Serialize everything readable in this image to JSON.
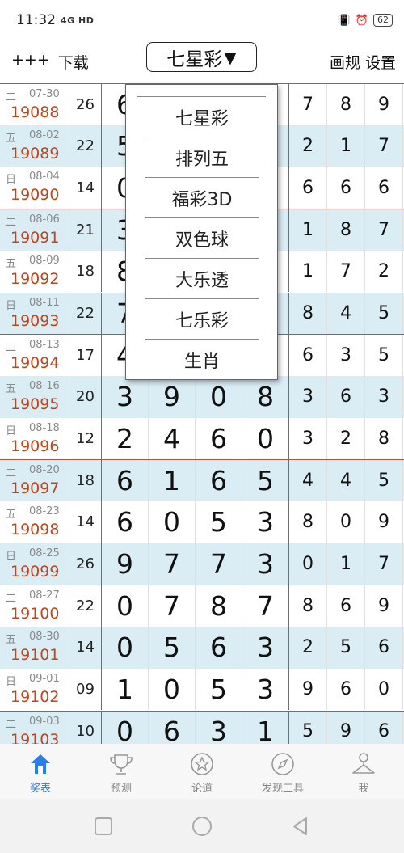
{
  "status": {
    "time": "11:32",
    "network": "4G HD",
    "battery": "62"
  },
  "header": {
    "left_items": [
      "+++",
      "下载"
    ],
    "selector_label": "七星彩",
    "selector_arrow": "▼",
    "right_items": [
      "画规",
      "设置"
    ]
  },
  "dropdown": {
    "items": [
      "七星彩",
      "排列五",
      "福彩3D",
      "双色球",
      "大乐透",
      "七乐彩",
      "生肖"
    ]
  },
  "table": {
    "rows": [
      {
        "weekday": "二",
        "date": "07-30",
        "issue": "19088",
        "sum": "26",
        "digits": [
          "6",
          "",
          "",
          ""
        ],
        "tail": [
          "7",
          "8",
          "9"
        ]
      },
      {
        "weekday": "五",
        "date": "08-02",
        "issue": "19089",
        "sum": "22",
        "digits": [
          "5",
          "",
          "",
          ""
        ],
        "tail": [
          "2",
          "1",
          "7"
        ]
      },
      {
        "weekday": "日",
        "date": "08-04",
        "issue": "19090",
        "sum": "14",
        "digits": [
          "0",
          "",
          "",
          ""
        ],
        "tail": [
          "6",
          "6",
          "6"
        ]
      },
      {
        "weekday": "二",
        "date": "08-06",
        "issue": "19091",
        "sum": "21",
        "digits": [
          "3",
          "",
          "",
          ""
        ],
        "tail": [
          "1",
          "8",
          "7"
        ]
      },
      {
        "weekday": "五",
        "date": "08-09",
        "issue": "19092",
        "sum": "18",
        "digits": [
          "8",
          "",
          "",
          ""
        ],
        "tail": [
          "1",
          "7",
          "2"
        ]
      },
      {
        "weekday": "日",
        "date": "08-11",
        "issue": "19093",
        "sum": "22",
        "digits": [
          "7",
          "",
          "",
          ""
        ],
        "tail": [
          "8",
          "4",
          "5"
        ]
      },
      {
        "weekday": "二",
        "date": "08-13",
        "issue": "19094",
        "sum": "17",
        "digits": [
          "4",
          "",
          "",
          ""
        ],
        "tail": [
          "6",
          "3",
          "5"
        ]
      },
      {
        "weekday": "五",
        "date": "08-16",
        "issue": "19095",
        "sum": "20",
        "digits": [
          "3",
          "9",
          "0",
          "8"
        ],
        "tail": [
          "3",
          "6",
          "3"
        ]
      },
      {
        "weekday": "日",
        "date": "08-18",
        "issue": "19096",
        "sum": "12",
        "digits": [
          "2",
          "4",
          "6",
          "0"
        ],
        "tail": [
          "3",
          "2",
          "8"
        ]
      },
      {
        "weekday": "二",
        "date": "08-20",
        "issue": "19097",
        "sum": "18",
        "digits": [
          "6",
          "1",
          "6",
          "5"
        ],
        "tail": [
          "4",
          "4",
          "5"
        ]
      },
      {
        "weekday": "五",
        "date": "08-23",
        "issue": "19098",
        "sum": "14",
        "digits": [
          "6",
          "0",
          "5",
          "3"
        ],
        "tail": [
          "8",
          "0",
          "9"
        ]
      },
      {
        "weekday": "日",
        "date": "08-25",
        "issue": "19099",
        "sum": "26",
        "digits": [
          "9",
          "7",
          "7",
          "3"
        ],
        "tail": [
          "0",
          "1",
          "7"
        ]
      },
      {
        "weekday": "二",
        "date": "08-27",
        "issue": "19100",
        "sum": "22",
        "digits": [
          "0",
          "7",
          "8",
          "7"
        ],
        "tail": [
          "8",
          "6",
          "9"
        ]
      },
      {
        "weekday": "五",
        "date": "08-30",
        "issue": "19101",
        "sum": "14",
        "digits": [
          "0",
          "5",
          "6",
          "3"
        ],
        "tail": [
          "2",
          "5",
          "6"
        ]
      },
      {
        "weekday": "日",
        "date": "09-01",
        "issue": "19102",
        "sum": "09",
        "digits": [
          "1",
          "0",
          "5",
          "3"
        ],
        "tail": [
          "9",
          "6",
          "0"
        ]
      },
      {
        "weekday": "二",
        "date": "09-03",
        "issue": "19103",
        "sum": "10",
        "digits": [
          "0",
          "6",
          "3",
          "1"
        ],
        "tail": [
          "5",
          "9",
          "6"
        ]
      }
    ]
  },
  "tabs": [
    {
      "label": "奖表",
      "icon": "home-icon",
      "active": true
    },
    {
      "label": "预测",
      "icon": "trophy-icon",
      "active": false
    },
    {
      "label": "论道",
      "icon": "star-circle-icon",
      "active": false
    },
    {
      "label": "发现工具",
      "icon": "compass-icon",
      "active": false
    },
    {
      "label": "我",
      "icon": "person-icon",
      "active": false
    }
  ],
  "colors": {
    "accent": "#2b7de9",
    "issue": "#c0451a",
    "row_alt": "#daedf4",
    "grid_red": "#c0503a"
  }
}
